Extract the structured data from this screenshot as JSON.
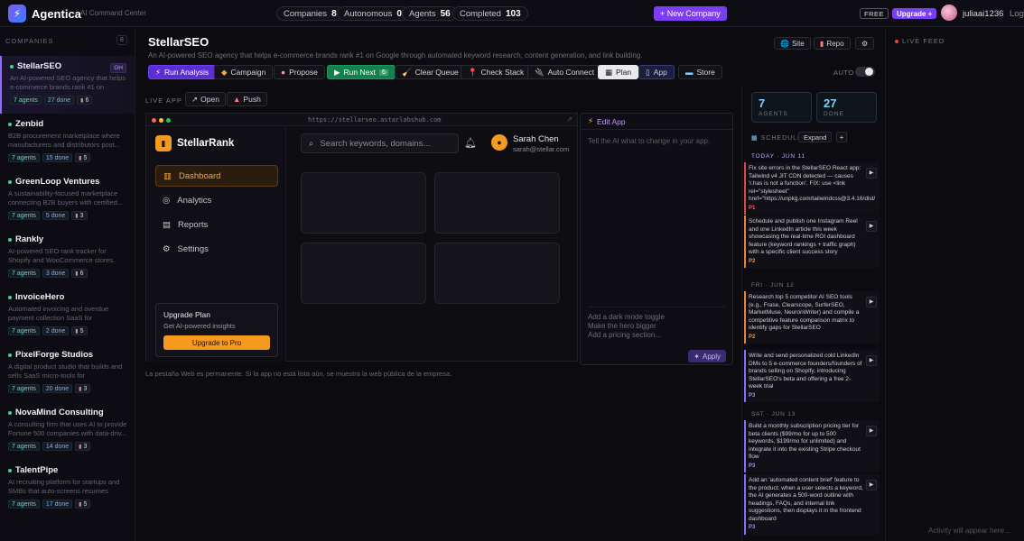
{
  "topbar": {
    "brand": "Agentica",
    "brand_sub": "AI Command Center",
    "stats": [
      {
        "label": "Companies",
        "value": "8"
      },
      {
        "label": "Autonomous",
        "value": "0"
      },
      {
        "label": "Agents",
        "value": "56"
      },
      {
        "label": "Completed",
        "value": "103"
      }
    ],
    "new_company": "+ New Company",
    "plan_tag": "FREE",
    "upgrade": "Upgrade +",
    "username": "juliaai1236",
    "logout": "Logo"
  },
  "sidebar": {
    "heading": "COMPANIES",
    "count": "8",
    "companies": [
      {
        "name": "StellarSEO",
        "desc": "An AI-powered SEO agency that helps e-commerce brands rank #1 on Google...",
        "agents": "7 agents",
        "done": "27 done",
        "tasks": "6",
        "badge": "GH"
      },
      {
        "name": "Zenbid",
        "desc": "B2B procurement marketplace where manufacturers and distributors post...",
        "agents": "7 agents",
        "done": "15 done",
        "tasks": "5"
      },
      {
        "name": "GreenLoop Ventures",
        "desc": "A sustainability-focused marketplace connecting B2B buyers with certified...",
        "agents": "7 agents",
        "done": "5 done",
        "tasks": "3"
      },
      {
        "name": "Rankly",
        "desc": "AI-powered SEO rank tracker for Shopify and WooCommerce stores. Monitor...",
        "agents": "7 agents",
        "done": "3 done",
        "tasks": "6"
      },
      {
        "name": "InvoiceHero",
        "desc": "Automated invoicing and overdue payment collection SaaS for freelancer...",
        "agents": "7 agents",
        "done": "2 done",
        "tasks": "5"
      },
      {
        "name": "PixelForge Studios",
        "desc": "A digital product studio that builds and sells SaaS micro-tools for solopreneurs...",
        "agents": "7 agents",
        "done": "20 done",
        "tasks": "3"
      },
      {
        "name": "NovaMind Consulting",
        "desc": "A consulting firm that uses AI to provide Fortune 500 companies with data-driv...",
        "agents": "7 agents",
        "done": "14 done",
        "tasks": "3"
      },
      {
        "name": "TalentPipe",
        "desc": "AI recruiting platform for startups and SMBs that auto-screens resumes again...",
        "agents": "7 agents",
        "done": "17 done",
        "tasks": "5"
      }
    ]
  },
  "main": {
    "title": "StellarSEO",
    "subtitle": "An AI-powered SEO agency that helps e-commerce brands rank #1 on Google through automated keyword research, content generation, and link building.",
    "site_btn": "Site",
    "repo_btn": "Repo",
    "toolbar": {
      "run_analysis": "Run Analysis",
      "campaign": "Campaign",
      "propose": "Propose",
      "run_next": "Run Next",
      "run_next_count": "6",
      "clear_queue": "Clear Queue",
      "check_stack": "Check Stack",
      "auto_connect": "Auto Connect",
      "plan": "Plan",
      "app": "App",
      "store": "Store",
      "auto_label": "AUTO"
    },
    "live_app_label": "LIVE APP",
    "open_btn": "Open",
    "push_btn": "Push",
    "note": "La pestaña Web es permanente. Si la app no está lista aún, se muestra la web pública de la empresa."
  },
  "preview": {
    "url": "https://stellarseo.astarlabshub.com",
    "app_name": "StellarRank",
    "nav": [
      "Dashboard",
      "Analytics",
      "Reports",
      "Settings"
    ],
    "search_placeholder": "Search keywords, domains...",
    "user_name": "Sarah Chen",
    "user_email": "sarah@stellar.com",
    "upgrade_title": "Upgrade Plan",
    "upgrade_sub": "Get AI-powered insights",
    "upgrade_btn": "Upgrade to Pro"
  },
  "edit_app": {
    "title": "Edit App",
    "placeholder": "Tell the AI what to change in your app.",
    "suggestions": [
      "Add a dark mode toggle",
      "Make the hero bigger",
      "Add a pricing section..."
    ],
    "apply": "Apply"
  },
  "schedule": {
    "agents_value": "7",
    "agents_label": "AGENTS",
    "done_value": "27",
    "done_label": "DONE",
    "label": "SCHEDULE",
    "expand": "Expand",
    "plus": "+",
    "days": [
      {
        "label": "TODAY · JUN 11"
      },
      {
        "label": "FRI · JUN 12"
      },
      {
        "label": "SAT · JUN 13"
      }
    ],
    "tasks": [
      {
        "text": "Fix site errors in the StellarSEO React app: Tailwind v4 JIT CDN detected — causes 'r.has is not a function'. FIX: use <link rel=\"stylesheet\" href=\"https://unpkg.com/tailwindcss@3.4.16/dist/",
        "prio": "P1"
      },
      {
        "text": "Schedule and publish one Instagram Reel and one LinkedIn article this week showcasing the real-time ROI dashboard feature (keyword rankings + traffic graph) with a specific client success story",
        "prio": "P2"
      },
      {
        "text": "Research top 5 competitor AI SEO tools (e.g., Frase, Clearscope, SurferSEO, MarketMuse, NeuronWriter) and compile a competitive feature comparison matrix to identify gaps for StellarSEO",
        "prio": "P2"
      },
      {
        "text": "Write and send personalized cold LinkedIn DMs to 5 e-commerce founders/founders of brands selling on Shopify, introducing StellarSEO's beta and offering a free 2-week trial",
        "prio": "P3"
      },
      {
        "text": "Build a monthly subscription pricing tier for beta clients ($99/mo for up to 500 keywords, $199/mo for unlimited) and integrate it into the existing Stripe checkout flow",
        "prio": "P3"
      },
      {
        "text": "Add an 'automated content brief' feature to the product: when a user selects a keyword, the AI generates a 500-word outline with headings, FAQs, and internal link suggestions, then displays it in the frontend dashboard",
        "prio": "P3"
      }
    ]
  },
  "feed": {
    "heading": "LIVE FEED",
    "empty": "Activity will appear here..."
  },
  "colors": {
    "accent": "#7b3ff2",
    "orange": "#f39a22",
    "green": "#15804b"
  }
}
